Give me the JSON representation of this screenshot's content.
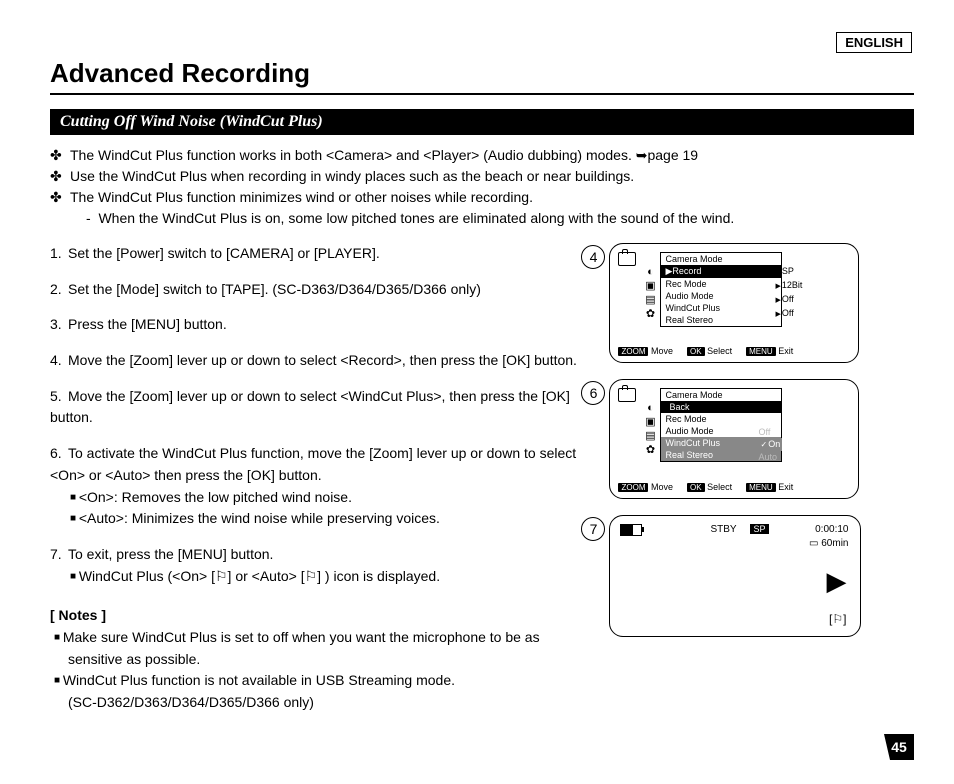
{
  "lang": "ENGLISH",
  "title": "Advanced Recording",
  "section": "Cutting Off Wind Noise (WindCut Plus)",
  "intro1": "The WindCut Plus function works in both <Camera> and <Player> (Audio dubbing) modes. ➥page 19",
  "intro2": "Use the WindCut Plus when recording in windy places such as the beach or near buildings.",
  "intro3": "The WindCut Plus function minimizes wind or other noises while recording.",
  "intro3sub": "When the WindCut Plus is on, some low pitched tones are eliminated along with the sound of the wind.",
  "step1": "Set the [Power] switch to [CAMERA] or [PLAYER].",
  "step2": "Set the [Mode] switch to [TAPE]. (SC-D363/D364/D365/D366 only)",
  "step3": "Press the [MENU] button.",
  "step4": "Move the [Zoom] lever up or down to select <Record>, then press the [OK] button.",
  "step5": "Move the [Zoom] lever up or down to select <WindCut Plus>, then press the [OK] button.",
  "step6a": "To activate the WindCut Plus function, move the [Zoom] lever up or down to select <On> or <Auto> then press the [OK] button.",
  "step6b": "<On>: Removes the low pitched wind noise.",
  "step6c": "<Auto>: Minimizes the wind noise while preserving voices.",
  "step7a": "To exit, press the [MENU] button.",
  "step7b": "WindCut Plus (<On> [⚐]  or <Auto> [⚐] ) icon is displayed.",
  "notes_hdr": "[ Notes ]",
  "note1": "Make sure WindCut Plus is set to off when you want the microphone to be as sensitive as possible.",
  "note2": "WindCut Plus function is not available in USB Streaming mode.",
  "note2b": "(SC-D362/D363/D364/D365/D366 only)",
  "fig4": {
    "menu_title": "Camera Mode",
    "r0": "Record",
    "r1": "Rec Mode",
    "r2": "Audio Mode",
    "r3": "WindCut Plus",
    "r4": "Real Stereo",
    "v1": "SP",
    "v2": "12Bit",
    "v3": "Off",
    "v4": "Off",
    "f_zoom": "ZOOM",
    "f_move": "Move",
    "f_ok": "OK",
    "f_sel": "Select",
    "f_menu": "MENU",
    "f_exit": "Exit"
  },
  "fig6": {
    "menu_title": "Camera Mode",
    "r0": "Back",
    "r1": "Rec Mode",
    "r2": "Audio Mode",
    "r3": "WindCut Plus",
    "r4": "Real Stereo",
    "o1": "Off",
    "o2": "On",
    "o3": "Auto"
  },
  "fig7": {
    "stby": "STBY",
    "sp": "SP",
    "time": "0:00:10",
    "min": "60min"
  },
  "pagenum": "45"
}
